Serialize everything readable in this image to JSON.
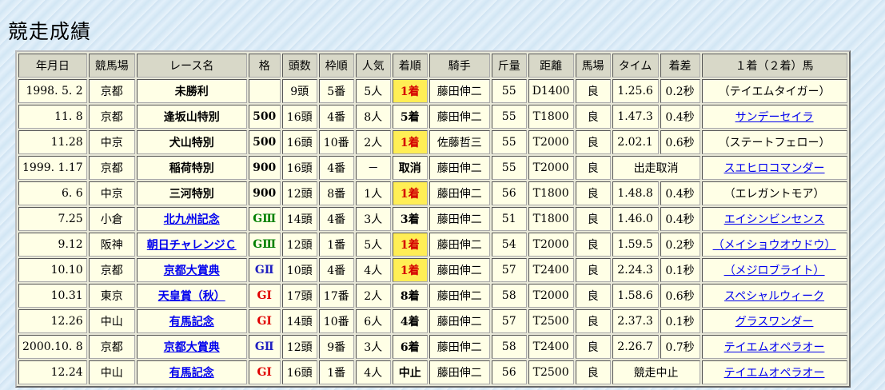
{
  "title": "競走成績",
  "headers": [
    "年月日",
    "競馬場",
    "レース名",
    "格",
    "頭数",
    "枠順",
    "人気",
    "着順",
    "騎手",
    "斤量",
    "距離",
    "馬場",
    "タイム",
    "着差",
    "１着（２着）馬"
  ],
  "rows": [
    {
      "date": "1998. 5. 2",
      "course": "京都",
      "race": "未勝利",
      "race_link": false,
      "grade": "",
      "grade_class": "",
      "runners": "9頭",
      "gate": "5番",
      "pop": "5人",
      "finish": "1着",
      "win": true,
      "jockey": "藤田伸二",
      "weight": "55",
      "dist": "D1400",
      "track": "良",
      "time": "1.25.6",
      "margin": "0.2秒",
      "merged": "",
      "horse": "（テイエムタイガー）",
      "horse_link": false
    },
    {
      "date": "11. 8",
      "course": "京都",
      "race": "逢坂山特別",
      "race_link": false,
      "grade": "500",
      "grade_class": "cls",
      "runners": "16頭",
      "gate": "4番",
      "pop": "8人",
      "finish": "5着",
      "win": false,
      "jockey": "藤田伸二",
      "weight": "55",
      "dist": "T1800",
      "track": "良",
      "time": "1.47.3",
      "margin": "0.4秒",
      "merged": "",
      "horse": "サンデーセイラ",
      "horse_link": true
    },
    {
      "date": "11.28",
      "course": "中京",
      "race": "犬山特別",
      "race_link": false,
      "grade": "500",
      "grade_class": "cls",
      "runners": "16頭",
      "gate": "10番",
      "pop": "2人",
      "finish": "1着",
      "win": true,
      "jockey": "佐藤哲三",
      "weight": "55",
      "dist": "T2000",
      "track": "良",
      "time": "2.02.1",
      "margin": "0.6秒",
      "merged": "",
      "horse": "（ステートフェロー）",
      "horse_link": false
    },
    {
      "date": "1999. 1.17",
      "course": "京都",
      "race": "稲荷特別",
      "race_link": false,
      "grade": "900",
      "grade_class": "cls",
      "runners": "16頭",
      "gate": "4番",
      "pop": "－",
      "finish": "取消",
      "win": false,
      "jockey": "藤田伸二",
      "weight": "55",
      "dist": "T2000",
      "track": "良",
      "time": "",
      "margin": "",
      "merged": "出走取消",
      "horse": "スエヒロコマンダー",
      "horse_link": true
    },
    {
      "date": "6. 6",
      "course": "中京",
      "race": "三河特別",
      "race_link": false,
      "grade": "900",
      "grade_class": "cls",
      "runners": "12頭",
      "gate": "8番",
      "pop": "1人",
      "finish": "1着",
      "win": true,
      "jockey": "藤田伸二",
      "weight": "56",
      "dist": "T1800",
      "track": "良",
      "time": "1.48.8",
      "margin": "0.4秒",
      "merged": "",
      "horse": "（エレガントモア）",
      "horse_link": false
    },
    {
      "date": "7.25",
      "course": "小倉",
      "race": "北九州記念",
      "race_link": true,
      "grade": "GⅢ",
      "grade_class": "g3",
      "runners": "14頭",
      "gate": "4番",
      "pop": "3人",
      "finish": "3着",
      "win": false,
      "jockey": "藤田伸二",
      "weight": "51",
      "dist": "T1800",
      "track": "良",
      "time": "1.46.0",
      "margin": "0.4秒",
      "merged": "",
      "horse": "エイシンビンセンス",
      "horse_link": true
    },
    {
      "date": "9.12",
      "course": "阪神",
      "race": "朝日チャレンジＣ",
      "race_link": true,
      "grade": "GⅢ",
      "grade_class": "g3",
      "runners": "12頭",
      "gate": "1番",
      "pop": "5人",
      "finish": "1着",
      "win": true,
      "jockey": "藤田伸二",
      "weight": "54",
      "dist": "T2000",
      "track": "良",
      "time": "1.59.5",
      "margin": "0.2秒",
      "merged": "",
      "horse": "（メイショウオウドウ）",
      "horse_link": true
    },
    {
      "date": "10.10",
      "course": "京都",
      "race": "京都大賞典",
      "race_link": true,
      "grade": "GⅡ",
      "grade_class": "g2",
      "runners": "10頭",
      "gate": "4番",
      "pop": "4人",
      "finish": "1着",
      "win": true,
      "jockey": "藤田伸二",
      "weight": "57",
      "dist": "T2400",
      "track": "良",
      "time": "2.24.3",
      "margin": "0.1秒",
      "merged": "",
      "horse": "（メジロブライト）",
      "horse_link": true
    },
    {
      "date": "10.31",
      "course": "東京",
      "race": "天皇賞（秋）",
      "race_link": true,
      "grade": "GⅠ",
      "grade_class": "g1",
      "runners": "17頭",
      "gate": "17番",
      "pop": "2人",
      "finish": "8着",
      "win": false,
      "jockey": "藤田伸二",
      "weight": "58",
      "dist": "T2000",
      "track": "良",
      "time": "1.58.6",
      "margin": "0.6秒",
      "merged": "",
      "horse": "スペシャルウィーク",
      "horse_link": true
    },
    {
      "date": "12.26",
      "course": "中山",
      "race": "有馬記念",
      "race_link": true,
      "grade": "GⅠ",
      "grade_class": "g1",
      "runners": "14頭",
      "gate": "10番",
      "pop": "6人",
      "finish": "4着",
      "win": false,
      "jockey": "藤田伸二",
      "weight": "57",
      "dist": "T2500",
      "track": "良",
      "time": "2.37.3",
      "margin": "0.1秒",
      "merged": "",
      "horse": "グラスワンダー",
      "horse_link": true
    },
    {
      "date": "2000.10. 8",
      "course": "京都",
      "race": "京都大賞典",
      "race_link": true,
      "grade": "GⅡ",
      "grade_class": "g2",
      "runners": "12頭",
      "gate": "9番",
      "pop": "3人",
      "finish": "6着",
      "win": false,
      "jockey": "藤田伸二",
      "weight": "58",
      "dist": "T2400",
      "track": "良",
      "time": "2.26.7",
      "margin": "0.7秒",
      "merged": "",
      "horse": "テイエムオペラオー",
      "horse_link": true
    },
    {
      "date": "12.24",
      "course": "中山",
      "race": "有馬記念",
      "race_link": true,
      "grade": "GⅠ",
      "grade_class": "g1",
      "runners": "16頭",
      "gate": "1番",
      "pop": "4人",
      "finish": "中止",
      "win": false,
      "jockey": "藤田伸二",
      "weight": "56",
      "dist": "T2500",
      "track": "良",
      "time": "",
      "margin": "",
      "merged": "競走中止",
      "horse": "テイエムオペラオー",
      "horse_link": true
    }
  ]
}
